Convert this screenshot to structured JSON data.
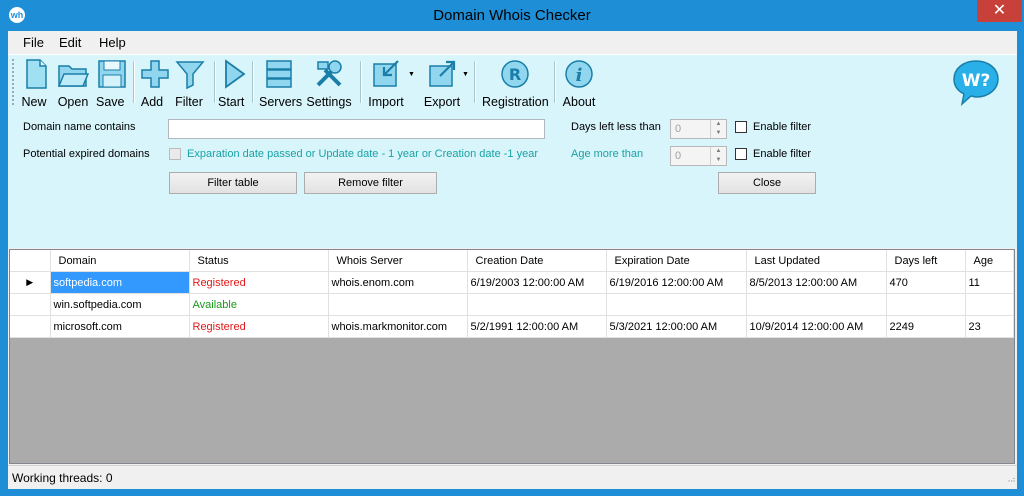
{
  "window": {
    "title": "Domain Whois Checker",
    "close_glyph": "✕",
    "app_icon": "wh"
  },
  "menu": {
    "items": [
      "File",
      "Edit",
      "Help"
    ]
  },
  "toolbar": {
    "buttons": [
      {
        "label": "New",
        "icon": "new-document-icon"
      },
      {
        "label": "Open",
        "icon": "open-folder-icon"
      },
      {
        "label": "Save",
        "icon": "save-floppy-icon"
      },
      {
        "label": "Add",
        "icon": "add-plus-icon"
      },
      {
        "label": "Filter",
        "icon": "filter-funnel-icon"
      },
      {
        "label": "Start",
        "icon": "play-icon"
      },
      {
        "label": "Servers",
        "icon": "servers-icon"
      },
      {
        "label": "Settings",
        "icon": "tools-icon"
      },
      {
        "label": "Import",
        "icon": "import-icon"
      },
      {
        "label": "Export",
        "icon": "export-icon"
      },
      {
        "label": "Registration",
        "icon": "registration-icon"
      },
      {
        "label": "About",
        "icon": "info-icon"
      }
    ],
    "logo_text": "W?"
  },
  "filter": {
    "domain_contains_label": "Domain name contains",
    "domain_contains_value": "",
    "potential_expired_label": "Potential expired domains",
    "expired_criteria_label": "Exparation date passed or Update date - 1 year or Creation date -1 year",
    "days_left_label": "Days left less than",
    "days_left_value": "0",
    "age_more_label": "Age more than",
    "age_more_value": "0",
    "enable_filter_label": "Enable filter",
    "filter_table_button": "Filter table",
    "remove_filter_button": "Remove filter",
    "close_button": "Close"
  },
  "table": {
    "columns": [
      "Domain",
      "Status",
      "Whois Server",
      "Creation Date",
      "Expiration Date",
      "Last Updated",
      "Days left",
      "Age"
    ],
    "rows": [
      {
        "domain": "softpedia.com",
        "status": "Registered",
        "status_color": "#e01a1a",
        "whois": "whois.enom.com",
        "created": "6/19/2003 12:00:00 AM",
        "expires": "6/19/2016 12:00:00 AM",
        "updated": "8/5/2013 12:00:00 AM",
        "days_left": "470",
        "age": "11"
      },
      {
        "domain": "win.softpedia.com",
        "status": "Available",
        "status_color": "#1a9a1a",
        "whois": "",
        "created": "",
        "expires": "",
        "updated": "",
        "days_left": "",
        "age": ""
      },
      {
        "domain": "microsoft.com",
        "status": "Registered",
        "status_color": "#e01a1a",
        "whois": "whois.markmonitor.com",
        "created": "5/2/1991 12:00:00 AM",
        "expires": "5/3/2021 12:00:00 AM",
        "updated": "10/9/2014 12:00:00 AM",
        "days_left": "2249",
        "age": "23"
      }
    ]
  },
  "status_bar": {
    "text": "Working threads: 0"
  },
  "colors": {
    "accent": "#1e8fd6",
    "panel": "#d7f5fb",
    "registered": "#e01a1a",
    "available": "#1a9a1a",
    "selection": "#3399ff",
    "hint_teal": "#1aa3a5"
  }
}
